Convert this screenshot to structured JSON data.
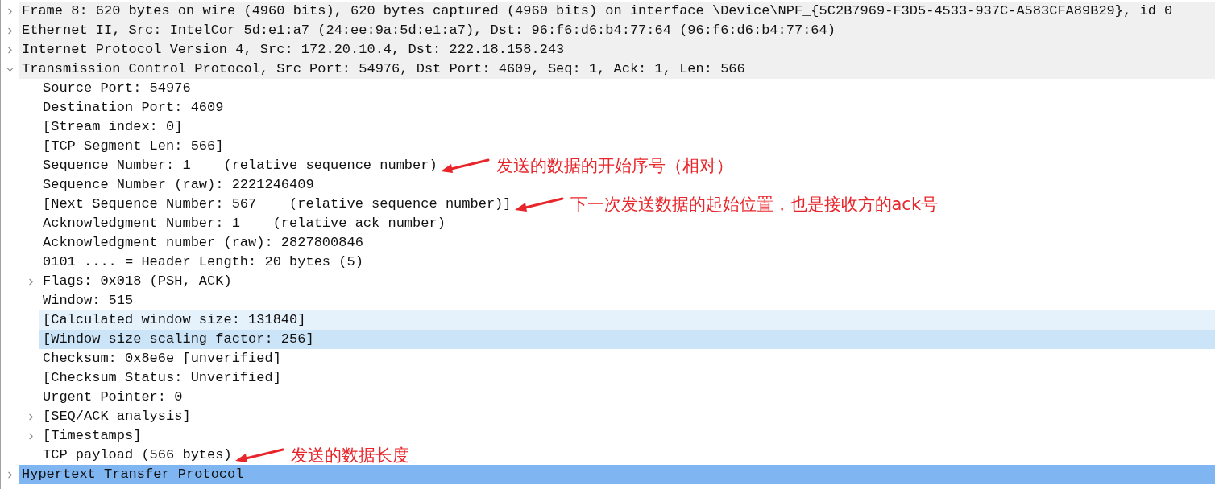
{
  "tree": [
    {
      "label": "Frame 8: 620 bytes on wire (4960 bits), 620 bytes captured (4960 bits) on interface \\Device\\NPF_{5C2B7969-F3D5-4533-937C-A583CFA89B29}, id 0",
      "expanded": false,
      "selected": false,
      "hovered": false,
      "highlighted": false
    },
    {
      "label": "Ethernet II, Src: IntelCor_5d:e1:a7 (24:ee:9a:5d:e1:a7), Dst: 96:f6:d6:b4:77:64 (96:f6:d6:b4:77:64)",
      "expanded": false,
      "selected": false,
      "hovered": false,
      "highlighted": false
    },
    {
      "label": "Internet Protocol Version 4, Src: 172.20.10.4, Dst: 222.18.158.243",
      "expanded": false,
      "selected": false,
      "hovered": false,
      "highlighted": false
    },
    {
      "label": "Transmission Control Protocol, Src Port: 54976, Dst Port: 4609, Seq: 1, Ack: 1, Len: 566",
      "expanded": true,
      "selected": false,
      "hovered": false,
      "highlighted": false,
      "children": [
        {
          "label": "Source Port: 54976",
          "selected": false,
          "hovered": false,
          "highlighted": false
        },
        {
          "label": "Destination Port: 4609",
          "selected": false,
          "hovered": false,
          "highlighted": false
        },
        {
          "label": "[Stream index: 0]",
          "selected": false,
          "hovered": false,
          "highlighted": false
        },
        {
          "label": "[TCP Segment Len: 566]",
          "selected": false,
          "hovered": false,
          "highlighted": false
        },
        {
          "label": "Sequence Number: 1    (relative sequence number)",
          "selected": false,
          "hovered": false,
          "highlighted": false,
          "annotation": "发送的数据的开始序号（相对）"
        },
        {
          "label": "Sequence Number (raw): 2221246409",
          "selected": false,
          "hovered": false,
          "highlighted": false
        },
        {
          "label": "[Next Sequence Number: 567    (relative sequence number)]",
          "selected": false,
          "hovered": false,
          "highlighted": false,
          "annotation": "下一次发送数据的起始位置，也是接收方的ack号"
        },
        {
          "label": "Acknowledgment Number: 1    (relative ack number)",
          "selected": false,
          "hovered": false,
          "highlighted": false
        },
        {
          "label": "Acknowledgment number (raw): 2827800846",
          "selected": false,
          "hovered": false,
          "highlighted": false
        },
        {
          "label": "0101 .... = Header Length: 20 bytes (5)",
          "selected": false,
          "hovered": false,
          "highlighted": false
        },
        {
          "label": "Flags: 0x018 (PSH, ACK)",
          "expanded": false,
          "selected": false,
          "hovered": false,
          "highlighted": false
        },
        {
          "label": "Window: 515",
          "selected": false,
          "hovered": false,
          "highlighted": false
        },
        {
          "label": "[Calculated window size: 131840]",
          "selected": false,
          "hovered": true,
          "highlighted": false
        },
        {
          "label": "[Window size scaling factor: 256]",
          "selected": false,
          "hovered": false,
          "highlighted": true
        },
        {
          "label": "Checksum: 0x8e6e [unverified]",
          "selected": false,
          "hovered": false,
          "highlighted": false
        },
        {
          "label": "[Checksum Status: Unverified]",
          "selected": false,
          "hovered": false,
          "highlighted": false
        },
        {
          "label": "Urgent Pointer: 0",
          "selected": false,
          "hovered": false,
          "highlighted": false
        },
        {
          "label": "[SEQ/ACK analysis]",
          "expanded": false,
          "selected": false,
          "hovered": false,
          "highlighted": false
        },
        {
          "label": "[Timestamps]",
          "expanded": false,
          "selected": false,
          "hovered": false,
          "highlighted": false
        },
        {
          "label": "TCP payload (566 bytes)",
          "selected": false,
          "hovered": false,
          "highlighted": false,
          "annotation": "发送的数据长度"
        }
      ]
    },
    {
      "label": "Hypertext Transfer Protocol",
      "expanded": false,
      "selected": true,
      "hovered": false,
      "highlighted": false
    }
  ]
}
